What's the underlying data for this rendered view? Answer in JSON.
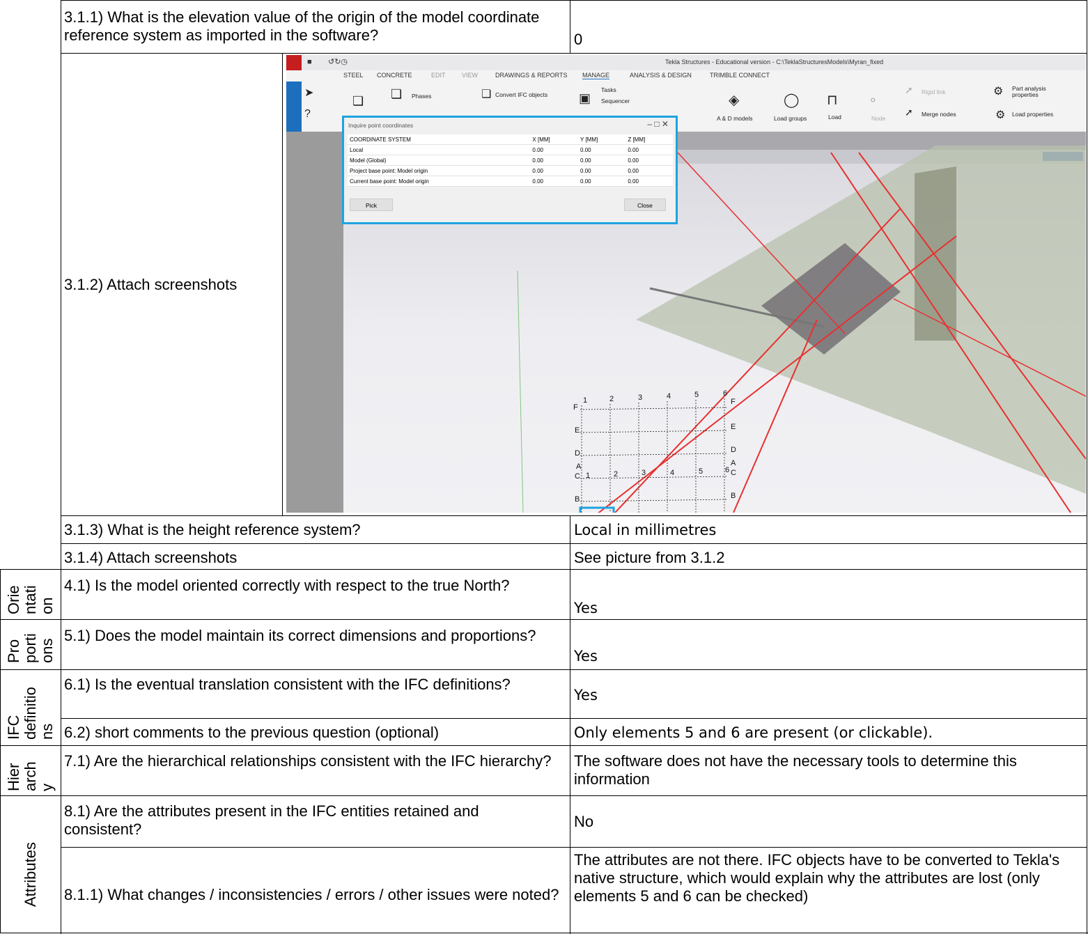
{
  "rows": {
    "q311": "3.1.1) What is the elevation value of the origin of the model coordinate reference system as imported in the software?",
    "a311": "0",
    "q312": "3.1.2) Attach screenshots",
    "q313": "3.1.3) What is the height reference system?",
    "a313": "Local in millimetres",
    "q314": "3.1.4) Attach screenshots",
    "a314": "See picture from 3.1.2",
    "q41": "4.1) Is the model oriented correctly with respect to the true North?",
    "a41": "Yes",
    "q51": "5.1) Does the model maintain its correct dimensions and proportions?",
    "a51": "Yes",
    "q61": "6.1) Is the eventual translation consistent with the IFC definitions?",
    "a61": "Yes",
    "q62": "6.2) short comments to the previous question (optional)",
    "a62": "Only elements 5 and 6 are present (or clickable).",
    "q71": "7.1) Are the hierarchical relationships consistent with the IFC hierarchy?",
    "a71": "The software does not have the necessary tools to determine this information",
    "q81": "8.1) Are the attributes present in the IFC entities retained and consistent?",
    "a81": "No",
    "q811": "8.1.1) What changes / inconsistencies / errors / other issues were noted?",
    "a811": "The attributes are not there. IFC objects have to be converted to Tekla's native structure, which would explain why the attributes are lost (only elements 5 and 6 can be checked)"
  },
  "sections": {
    "orientation": "Orie\nntati\non",
    "proportions": "Pro\nporti\nons",
    "ifc_definitions": "IFC\ndefinitio\nns",
    "hierarchy": "Hier\narch\ny",
    "attributes": "Attributes"
  },
  "screenshot": {
    "window_title": "Tekla Structures - Educational version - C:\\TeklaStructuresModels\\Myran_fixed",
    "menu": [
      "STEEL",
      "CONCRETE",
      "EDIT",
      "VIEW",
      "DRAWINGS & REPORTS",
      "MANAGE",
      "ANALYSIS & DESIGN",
      "TRIMBLE CONNECT"
    ],
    "ribbon": {
      "phases": "Phases",
      "convert": "Convert IFC objects",
      "tasks": "Tasks",
      "sequencer": "Sequencer",
      "ad_models": "A & D models",
      "load_groups": "Load groups",
      "load": "Load",
      "node": "Node",
      "rigid_link": "Rigid link",
      "merge_nodes": "Merge nodes",
      "part_analysis": "Part analysis properties",
      "load_properties": "Load properties"
    },
    "dialog": {
      "title": "Inquire point coordinates",
      "headers": [
        "COORDINATE SYSTEM",
        "X [MM]",
        "Y [MM]",
        "Z [MM]"
      ],
      "rows": [
        [
          "Local",
          "0.00",
          "0.00",
          "0.00"
        ],
        [
          "Model (Global)",
          "0.00",
          "0.00",
          "0.00"
        ],
        [
          "Project base point: Model origin",
          "0.00",
          "0.00",
          "0.00"
        ],
        [
          "Current base point: Model origin",
          "0.00",
          "0.00",
          "0.00"
        ]
      ],
      "pick": "Pick",
      "close": "Close"
    },
    "grid": {
      "cols_top": [
        "1",
        "2",
        "3",
        "4",
        "5",
        "6"
      ],
      "cols_bottom": [
        "1",
        "2",
        "3",
        "4",
        "5",
        "6"
      ],
      "rows_left": [
        "F",
        "E",
        "D",
        "C",
        "B",
        "A"
      ],
      "rows_right": [
        "F",
        "E",
        "D",
        "C",
        "B",
        "A"
      ]
    },
    "colors": {
      "highlight": "#1ea3e0",
      "grid_red": "#e83030",
      "brand": "#c41e1e"
    }
  }
}
